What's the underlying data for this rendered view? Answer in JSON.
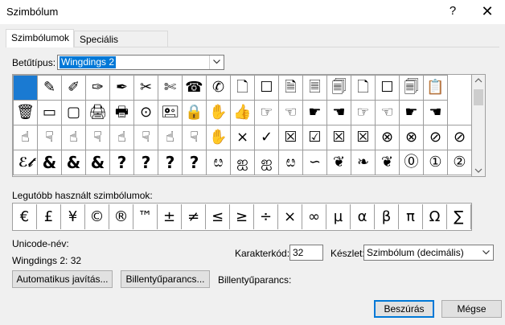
{
  "window": {
    "title": "Szimbólum",
    "help": "?",
    "close": "✕"
  },
  "tabs": [
    {
      "label": "Szimbólumok",
      "active": true
    },
    {
      "label": "Speciális karakterek",
      "active": false
    }
  ],
  "font": {
    "label": "Betűtípus:",
    "value": "Wingdings 2"
  },
  "symbols": [
    [
      "",
      "✎",
      "✐",
      "✑",
      "✒",
      "✂",
      "✄",
      "☎",
      "✆",
      "🗋",
      "☐",
      "🗎",
      "🗏",
      "🗐",
      "🗋",
      "☐",
      "🗐",
      "📋"
    ],
    [
      "🗑",
      "▭",
      "▢",
      "🖨",
      "🖶",
      "⊙",
      "🖭",
      "🔒",
      "✋",
      "👍",
      "☞",
      "☜",
      "☛",
      "☚",
      "☞",
      "☜",
      "☛",
      "☚"
    ],
    [
      "☝",
      "☟",
      "☝",
      "☟",
      "☝",
      "☟",
      "☝",
      "☟",
      "✋",
      "×",
      "✓",
      "☒",
      "☑",
      "☒",
      "☒",
      "⊗",
      "⊗",
      "⊘",
      "⊘"
    ],
    [
      "ℰ𝓉",
      "&",
      "&",
      "&",
      "?",
      "?",
      "?",
      "?",
      "ೞ",
      "ஐ",
      "ஐ",
      "ೞ",
      "∽",
      "❦",
      "❧",
      "❦",
      "⓪",
      "①",
      "②"
    ]
  ],
  "recent": {
    "label": "Legutóbb használt szimbólumok:",
    "items": [
      "€",
      "£",
      "¥",
      "©",
      "®",
      "™",
      "±",
      "≠",
      "≤",
      "≥",
      "÷",
      "×",
      "∞",
      "µ",
      "α",
      "β",
      "π",
      "Ω",
      "∑"
    ]
  },
  "unicode": {
    "label": "Unicode-név:",
    "value": "Wingdings 2: 32"
  },
  "charcode": {
    "label": "Karakterkód:",
    "value": "32"
  },
  "charset": {
    "label": "Készlet:",
    "value": "Szimbólum (decimális)"
  },
  "buttons": {
    "autocorrect": "Automatikus javítás...",
    "shortcut_key": "Billentyűparancs...",
    "shortcut_label": "Billentyűparancs:",
    "insert": "Beszúrás",
    "cancel": "Mégse"
  },
  "colors": {
    "accent": "#0078d7",
    "selected_cell": "#1a7ad2"
  }
}
